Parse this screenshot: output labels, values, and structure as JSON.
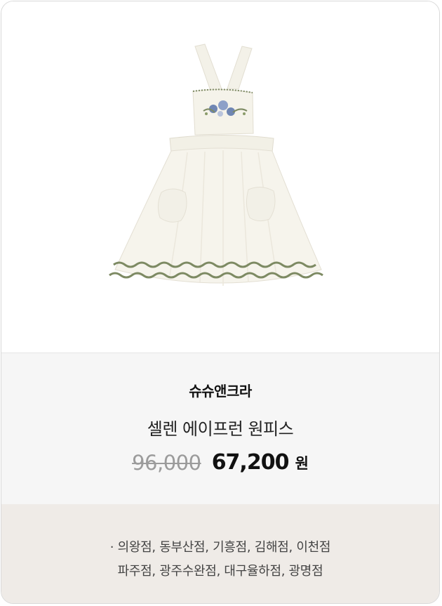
{
  "product": {
    "image_alt": "white apron dress with embroidered bib and zigzag trim",
    "brand": "슈슈앤크라",
    "name": "셀렌 에이프런 원피스",
    "original_price": "96,000",
    "sale_price": "67,200",
    "currency": "원"
  },
  "stores": {
    "line1": "· 의왕점, 동부산점, 기흥점, 김해점, 이천점",
    "line2": "파주점, 광주수완점, 대구율하점, 광명점"
  },
  "colors": {
    "info_bg": "#f6f6f6",
    "stores_bg": "#efebe7",
    "trim_green": "#7d8a63",
    "embroidery_blue": "#6f86b3"
  }
}
